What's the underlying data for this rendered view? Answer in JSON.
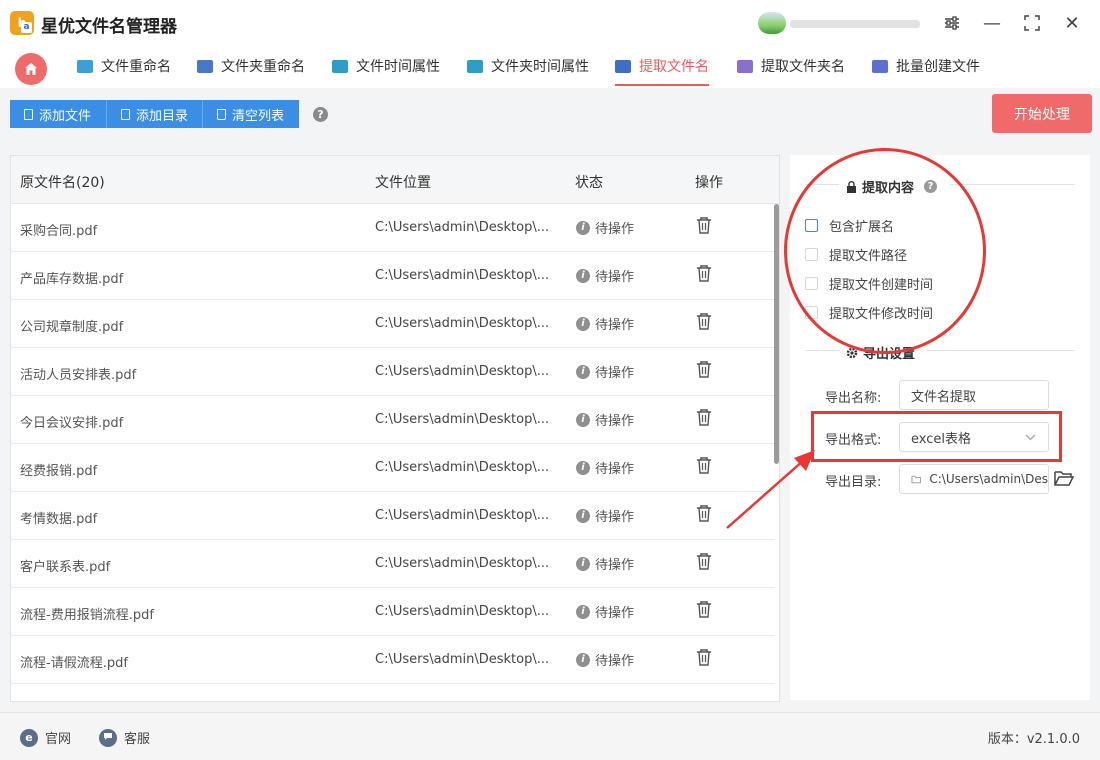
{
  "app": {
    "title": "星优文件名管理器",
    "logo_text": "b",
    "logo_badge": "a"
  },
  "window_controls": {
    "settings_icon": "sliders-icon",
    "minimize": "—",
    "maximize": "⛶",
    "close": "✕"
  },
  "tabs": [
    {
      "label": "文件重命名",
      "color": "#3aa0d8",
      "active": false
    },
    {
      "label": "文件夹重命名",
      "color": "#4a78c9",
      "active": false
    },
    {
      "label": "文件时间属性",
      "color": "#2f9ec7",
      "active": false
    },
    {
      "label": "文件夹时间属性",
      "color": "#2f9ec7",
      "active": false
    },
    {
      "label": "提取文件名",
      "color": "#3f6fc4",
      "active": true
    },
    {
      "label": "提取文件夹名",
      "color": "#8a6fd0",
      "active": false
    },
    {
      "label": "批量创建文件",
      "color": "#5a6fd0",
      "active": false
    }
  ],
  "toolbar": {
    "add_file": "添加文件",
    "add_dir": "添加目录",
    "clear_list": "清空列表",
    "help": "?",
    "start": "开始处理"
  },
  "table": {
    "headers": {
      "name": "原文件名(20)",
      "location": "文件位置",
      "status": "状态",
      "action": "操作"
    },
    "rows": [
      {
        "name": "采购合同.pdf",
        "location": "C:\\Users\\admin\\Desktop\\...",
        "status": "待操作"
      },
      {
        "name": "产品库存数据.pdf",
        "location": "C:\\Users\\admin\\Desktop\\...",
        "status": "待操作"
      },
      {
        "name": "公司规章制度.pdf",
        "location": "C:\\Users\\admin\\Desktop\\...",
        "status": "待操作"
      },
      {
        "name": "活动人员安排表.pdf",
        "location": "C:\\Users\\admin\\Desktop\\...",
        "status": "待操作"
      },
      {
        "name": "今日会议安排.pdf",
        "location": "C:\\Users\\admin\\Desktop\\...",
        "status": "待操作"
      },
      {
        "name": "经费报销.pdf",
        "location": "C:\\Users\\admin\\Desktop\\...",
        "status": "待操作"
      },
      {
        "name": "考情数据.pdf",
        "location": "C:\\Users\\admin\\Desktop\\...",
        "status": "待操作"
      },
      {
        "name": "客户联系表.pdf",
        "location": "C:\\Users\\admin\\Desktop\\...",
        "status": "待操作"
      },
      {
        "name": "流程-费用报销流程.pdf",
        "location": "C:\\Users\\admin\\Desktop\\...",
        "status": "待操作"
      },
      {
        "name": "流程-请假流程.pdf",
        "location": "C:\\Users\\admin\\Desktop\\...",
        "status": "待操作"
      }
    ]
  },
  "extract": {
    "title": "提取内容",
    "help": "?",
    "options": [
      {
        "label": "包含扩展名",
        "checked": false
      },
      {
        "label": "提取文件路径",
        "checked": false
      },
      {
        "label": "提取文件创建时间",
        "checked": false
      },
      {
        "label": "提取文件修改时间",
        "checked": false
      }
    ]
  },
  "export": {
    "title": "导出设置",
    "name_label": "导出名称:",
    "name_value": "文件名提取",
    "format_label": "导出格式:",
    "format_value": "excel表格",
    "dir_label": "导出目录:",
    "dir_value": "C:\\Users\\admin\\Des"
  },
  "footer": {
    "website": "官网",
    "website_icon": "e",
    "service": "客服",
    "version": "版本：v2.1.0.0"
  },
  "colors": {
    "accent_red": "#f06a6a",
    "primary_blue": "#3a8ee6",
    "annotation_red": "#e53935"
  }
}
